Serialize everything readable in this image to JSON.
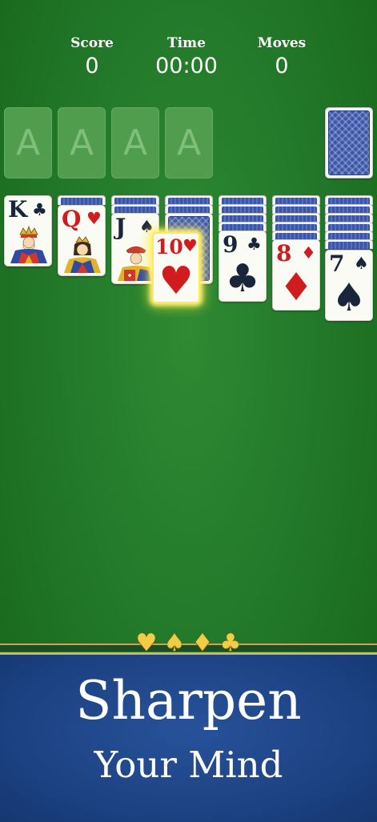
{
  "hud": {
    "score_label": "Score",
    "score_value": "0",
    "time_label": "Time",
    "time_value": "00:00",
    "moves_label": "Moves",
    "moves_value": "0"
  },
  "foundations": [
    "A",
    "A",
    "A",
    "A"
  ],
  "tableau": [
    {
      "rank": "K",
      "suit": "♣",
      "color": "black"
    },
    {
      "rank": "Q",
      "suit": "♥",
      "color": "red"
    },
    {
      "rank": "J",
      "suit": "♠",
      "color": "black"
    },
    {
      "rank": "10",
      "suit": "♥",
      "color": "red",
      "selected": true
    },
    {
      "rank": "9",
      "suit": "♣",
      "color": "black"
    },
    {
      "rank": "8",
      "suit": "♦",
      "color": "red"
    },
    {
      "rank": "7",
      "suit": "♠",
      "color": "black"
    }
  ],
  "banner": {
    "suits": [
      "♥",
      "♠",
      "♦",
      "♣"
    ],
    "line1": "Sharpen",
    "line2": "Your Mind"
  },
  "colors": {
    "felt": "#237a2a",
    "banner_blue": "#1d4384",
    "gold": "#f0cd45",
    "red_suit": "#d01c1f",
    "black_suit": "#18253b"
  }
}
